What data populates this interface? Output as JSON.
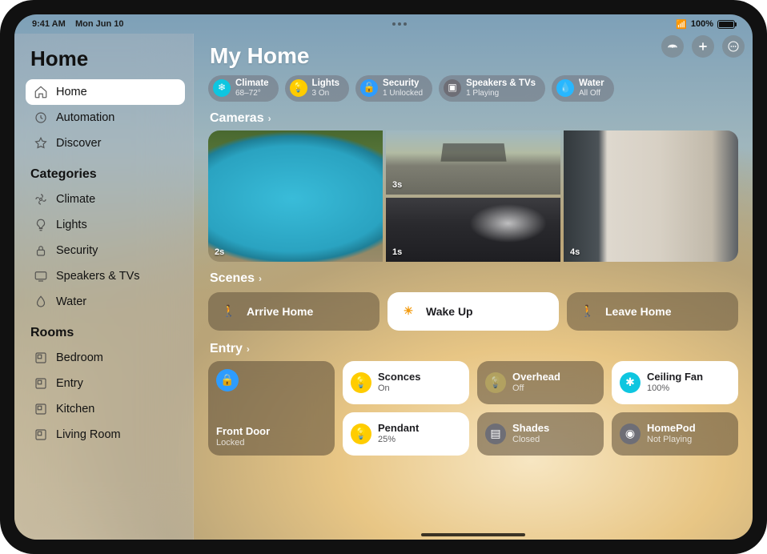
{
  "statusbar": {
    "time": "9:41 AM",
    "date": "Mon Jun 10",
    "battery": "100%"
  },
  "sidebar": {
    "title": "Home",
    "primary": [
      {
        "label": "Home",
        "icon": "house",
        "active": true
      },
      {
        "label": "Automation",
        "icon": "clock",
        "active": false
      },
      {
        "label": "Discover",
        "icon": "star",
        "active": false
      }
    ],
    "categoriesHeader": "Categories",
    "categories": [
      {
        "label": "Climate",
        "icon": "fan"
      },
      {
        "label": "Lights",
        "icon": "bulb"
      },
      {
        "label": "Security",
        "icon": "lock"
      },
      {
        "label": "Speakers & TVs",
        "icon": "tv"
      },
      {
        "label": "Water",
        "icon": "drop"
      }
    ],
    "roomsHeader": "Rooms",
    "rooms": [
      {
        "label": "Bedroom"
      },
      {
        "label": "Entry"
      },
      {
        "label": "Kitchen"
      },
      {
        "label": "Living Room"
      }
    ]
  },
  "header": {
    "title": "My Home",
    "actions": {
      "intercom": "intercom-icon",
      "add": "plus-icon",
      "more": "more-icon"
    }
  },
  "pills": [
    {
      "name": "Climate",
      "status": "68–72°",
      "iconColor": "bg-cyan",
      "icon": "fan"
    },
    {
      "name": "Lights",
      "status": "3 On",
      "iconColor": "bg-yellow",
      "icon": "bulb"
    },
    {
      "name": "Security",
      "status": "1 Unlocked",
      "iconColor": "bg-blue",
      "icon": "lock"
    },
    {
      "name": "Speakers & TVs",
      "status": "1 Playing",
      "iconColor": "bg-gray",
      "icon": "tv"
    },
    {
      "name": "Water",
      "status": "All Off",
      "iconColor": "bg-water",
      "icon": "drop"
    }
  ],
  "cameras": {
    "header": "Cameras",
    "items": [
      {
        "area": "pool",
        "ts": "2s"
      },
      {
        "area": "driveway",
        "ts": "3s"
      },
      {
        "area": "bedroom",
        "ts": "1s"
      },
      {
        "area": "living",
        "ts": "4s"
      }
    ]
  },
  "scenes": {
    "header": "Scenes",
    "items": [
      {
        "label": "Arrive Home",
        "on": false,
        "icon": "walk"
      },
      {
        "label": "Wake Up",
        "on": true,
        "icon": "sunrise"
      },
      {
        "label": "Leave Home",
        "on": false,
        "icon": "walk"
      }
    ]
  },
  "entry": {
    "header": "Entry",
    "tiles": [
      {
        "kind": "lock",
        "name": "Front Door",
        "status": "Locked",
        "on": false,
        "iconColor": "bg-blue",
        "span2": true
      },
      {
        "kind": "light",
        "name": "Sconces",
        "status": "On",
        "on": true,
        "iconColor": "bg-yellow"
      },
      {
        "kind": "light",
        "name": "Overhead",
        "status": "Off",
        "on": false,
        "iconColor": "bg-yellow"
      },
      {
        "kind": "fan",
        "name": "Ceiling Fan",
        "status": "100%",
        "on": true,
        "iconColor": "bg-cyan"
      },
      {
        "kind": "light",
        "name": "Pendant",
        "status": "25%",
        "on": true,
        "iconColor": "bg-yellow"
      },
      {
        "kind": "shades",
        "name": "Shades",
        "status": "Closed",
        "on": false,
        "iconColor": "bg-gray"
      },
      {
        "kind": "speaker",
        "name": "HomePod",
        "status": "Not Playing",
        "on": false,
        "iconColor": "bg-gray"
      }
    ]
  }
}
